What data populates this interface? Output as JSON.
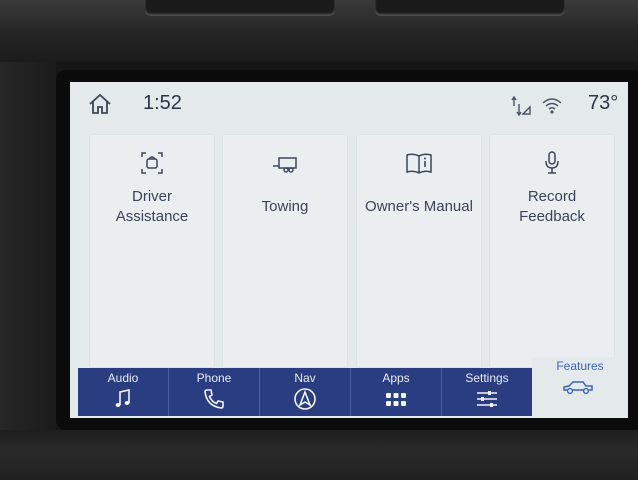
{
  "status_bar": {
    "time": "1:52",
    "temperature": "73°",
    "home_icon": "home-icon",
    "signal_icon": "data-signal-icon",
    "wifi_icon": "wifi-icon"
  },
  "tiles": [
    {
      "label_line1": "Driver",
      "label_line2": "Assistance",
      "icon": "driver-assistance-icon"
    },
    {
      "label_line1": "Towing",
      "label_line2": "",
      "icon": "trailer-icon"
    },
    {
      "label_line1": "Owner's Manual",
      "label_line2": "",
      "icon": "book-icon"
    },
    {
      "label_line1": "Record",
      "label_line2": "Feedback",
      "icon": "microphone-icon"
    }
  ],
  "nav_bar": {
    "items": [
      {
        "label": "Audio",
        "icon": "music-note-icon"
      },
      {
        "label": "Phone",
        "icon": "phone-icon"
      },
      {
        "label": "Nav",
        "icon": "navigation-arrow-icon"
      },
      {
        "label": "Apps",
        "icon": "apps-grid-icon"
      },
      {
        "label": "Settings",
        "icon": "settings-sliders-icon"
      }
    ],
    "active": {
      "label": "Features",
      "icon": "vehicle-icon"
    }
  },
  "colors": {
    "screen_bg": "#e4e9ec",
    "nav_bg": "#2a3d80",
    "accent": "#3d63b9",
    "text": "#2a3445"
  }
}
